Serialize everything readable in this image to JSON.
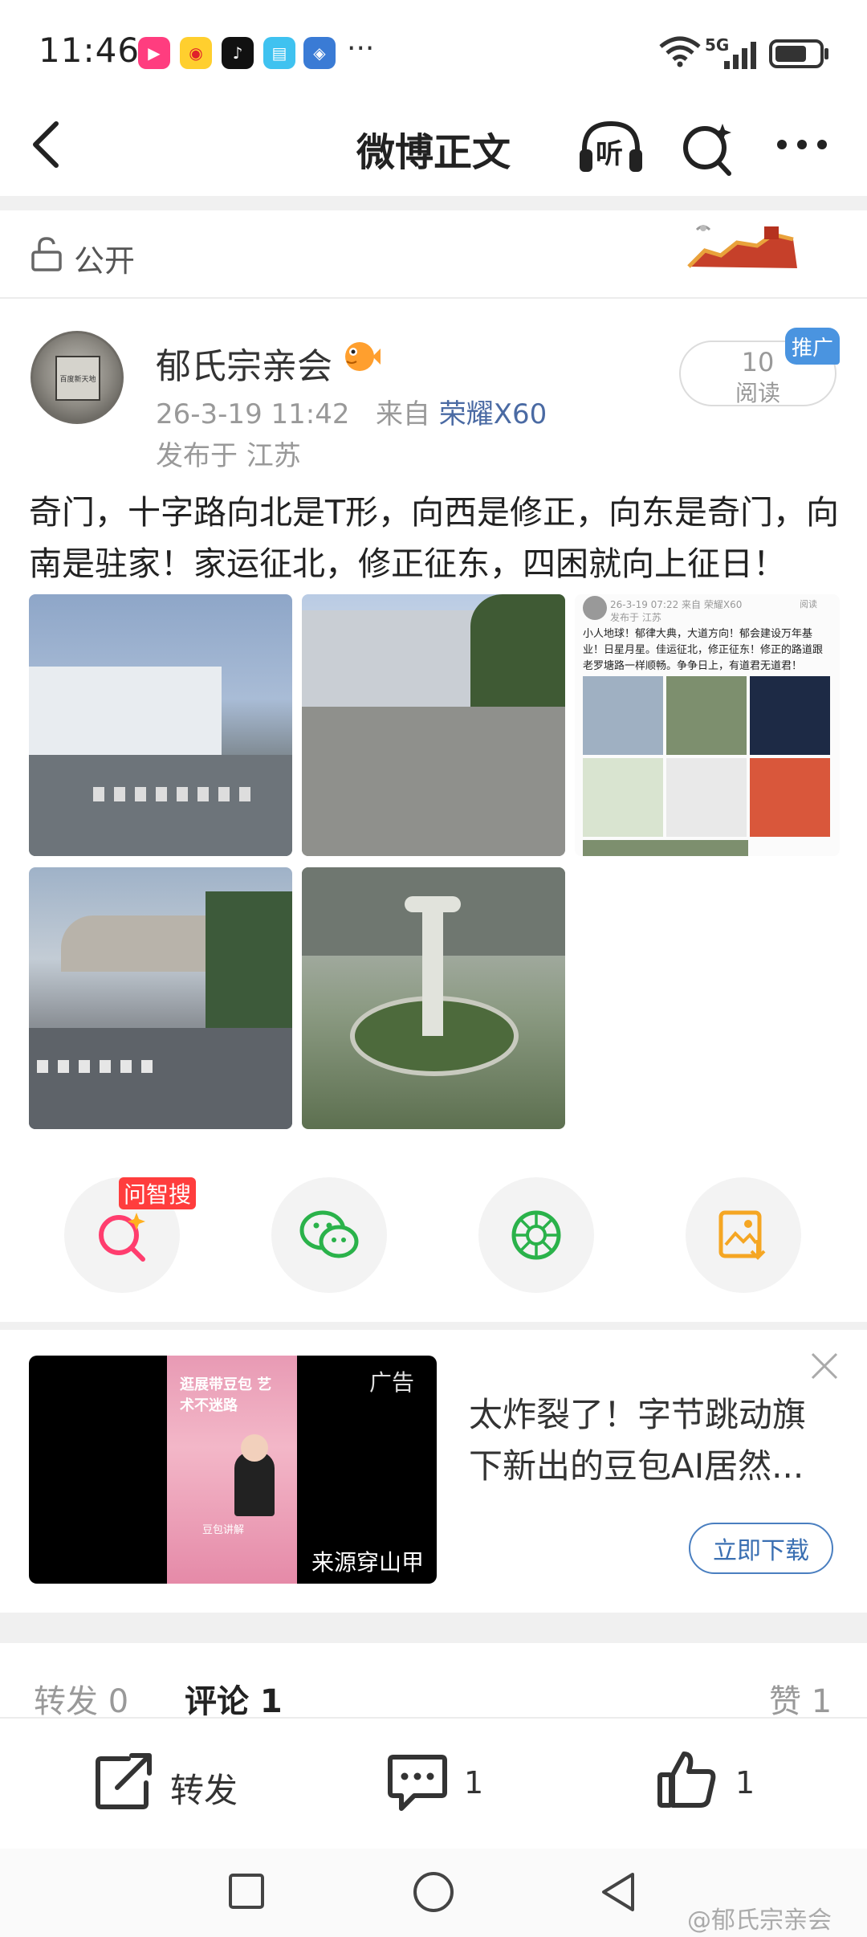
{
  "status_bar": {
    "time": "11:46",
    "network": "5G",
    "more": "···"
  },
  "header": {
    "title": "微博正文",
    "listen_label": "听"
  },
  "visibility": {
    "label": "公开"
  },
  "post": {
    "author": "郁氏宗亲会",
    "avatar_text": "百度新天地",
    "date": "26-3-19 11:42",
    "source_prefix": "来自",
    "device": "荣耀X60",
    "location": "发布于 江苏",
    "read_count": "10",
    "read_label": "阅读",
    "promo_badge": "推广",
    "text": "奇门，十字路向北是T形，向西是修正，向东是奇门，向南是驻家！家运征北，修正征东，四困就向上征日！"
  },
  "photos": {
    "p3_meta": "26-3-19 07:22  来自 荣耀X60",
    "p3_loc": "发布于 江苏",
    "p3_read": "阅读",
    "p3_text": "小人地球！郁律大典，大道方向！郁会建设万年基业！日星月星。佳运征北，修正征东！修正的路道跟老罗塘路一样顺畅。争争日上，有道君无道君！"
  },
  "actions": {
    "ask_badge": "问智搜"
  },
  "ad": {
    "tag": "广告",
    "source": "来源穿山甲",
    "title": "太炸裂了！字节跳动旗下新出的豆包AI居然...",
    "button": "立即下载",
    "image_text_top": "逛展带豆包 艺术不迷路",
    "image_text_bottom": "豆包讲解"
  },
  "tabs": {
    "repost": "转发 0",
    "comment": "评论 1",
    "like": "赞 1"
  },
  "bottom_bar": {
    "repost_label": "转发",
    "comment_count": "1",
    "like_count": "1"
  },
  "watermark": "@郁氏宗亲会",
  "colors": {
    "accent_blue": "#4a7fc0",
    "badge_red": "#ff3d3d",
    "promo_blue": "#4a94e0"
  }
}
